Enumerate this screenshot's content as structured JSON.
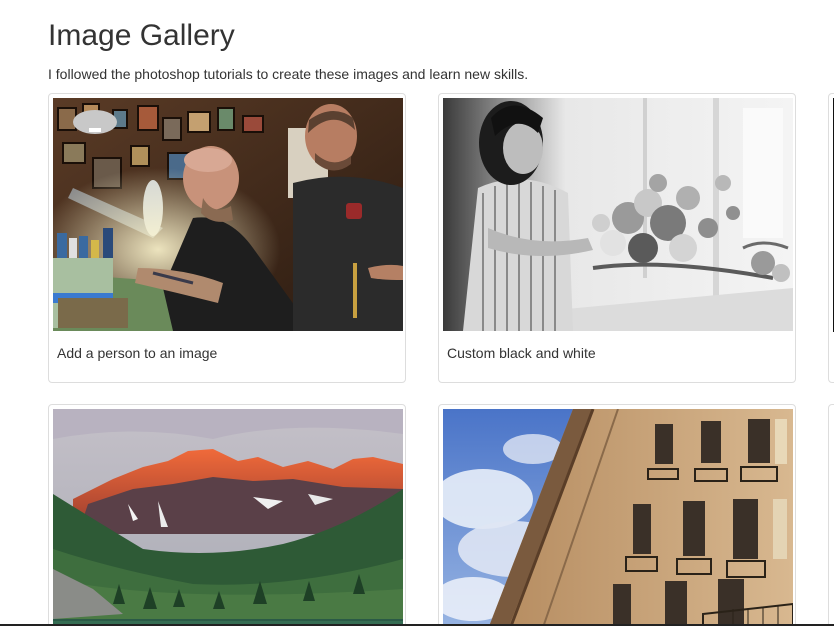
{
  "page": {
    "title": "Image Gallery",
    "intro": "I followed the photoshop tutorials to create these images and learn new skills."
  },
  "gallery": {
    "items": [
      {
        "caption": "Add a person to an image",
        "image": "workshop-artists-photo"
      },
      {
        "caption": "Custom black and white",
        "image": "florist-black-white-photo"
      },
      {
        "caption": "",
        "image": "mountain-lake-photo"
      },
      {
        "caption": "",
        "image": "building-facade-photo"
      }
    ]
  }
}
